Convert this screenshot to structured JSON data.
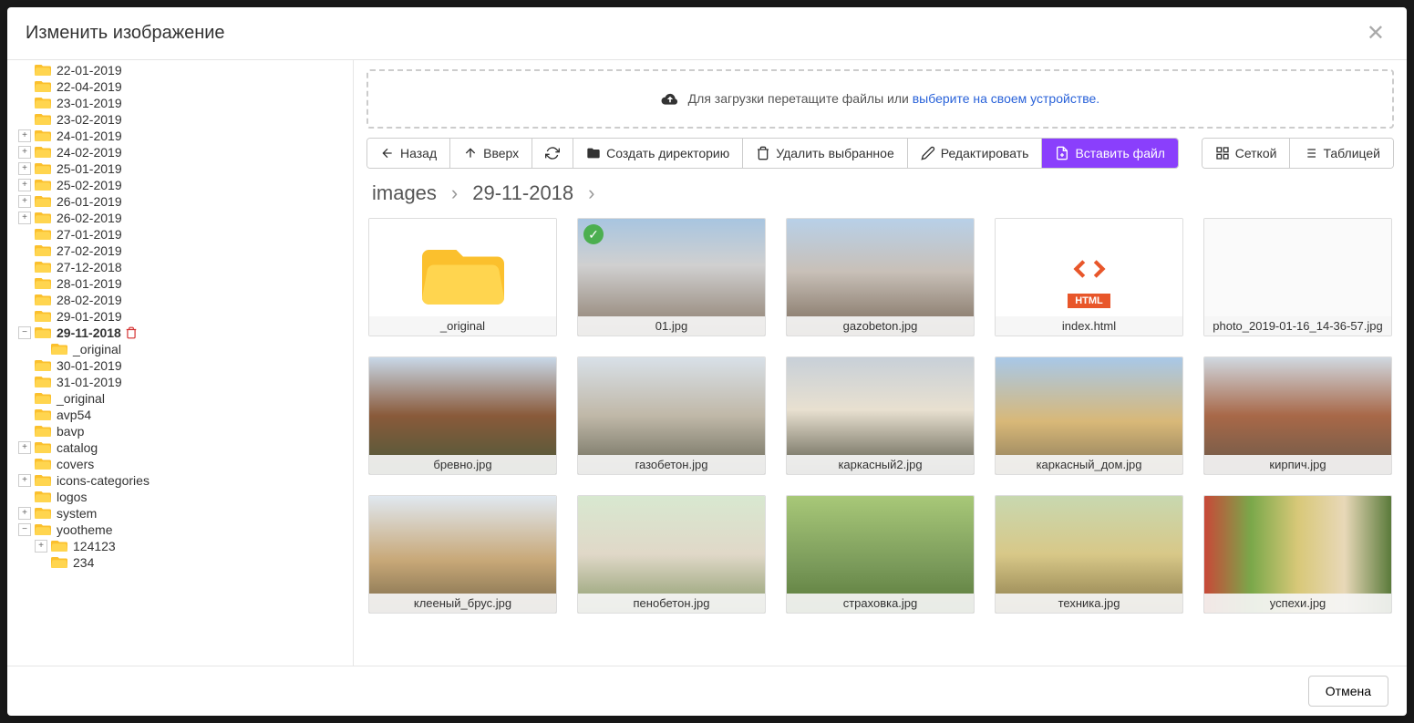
{
  "modal": {
    "title": "Изменить изображение",
    "cancel": "Отмена"
  },
  "tree": {
    "items": [
      {
        "label": "22-01-2019",
        "indent": 1,
        "expand": null
      },
      {
        "label": "22-04-2019",
        "indent": 1,
        "expand": null
      },
      {
        "label": "23-01-2019",
        "indent": 1,
        "expand": null
      },
      {
        "label": "23-02-2019",
        "indent": 1,
        "expand": null
      },
      {
        "label": "24-01-2019",
        "indent": 1,
        "expand": "+"
      },
      {
        "label": "24-02-2019",
        "indent": 1,
        "expand": "+"
      },
      {
        "label": "25-01-2019",
        "indent": 1,
        "expand": "+"
      },
      {
        "label": "25-02-2019",
        "indent": 1,
        "expand": "+"
      },
      {
        "label": "26-01-2019",
        "indent": 1,
        "expand": "+"
      },
      {
        "label": "26-02-2019",
        "indent": 1,
        "expand": "+"
      },
      {
        "label": "27-01-2019",
        "indent": 1,
        "expand": null
      },
      {
        "label": "27-02-2019",
        "indent": 1,
        "expand": null
      },
      {
        "label": "27-12-2018",
        "indent": 1,
        "expand": null
      },
      {
        "label": "28-01-2019",
        "indent": 1,
        "expand": null
      },
      {
        "label": "28-02-2019",
        "indent": 1,
        "expand": null
      },
      {
        "label": "29-01-2019",
        "indent": 1,
        "expand": null
      },
      {
        "label": "29-11-2018",
        "indent": 1,
        "expand": "−",
        "selected": true,
        "delete": true
      },
      {
        "label": "_original",
        "indent": 2,
        "expand": null
      },
      {
        "label": "30-01-2019",
        "indent": 1,
        "expand": null
      },
      {
        "label": "31-01-2019",
        "indent": 1,
        "expand": null
      },
      {
        "label": "_original",
        "indent": 1,
        "expand": null
      },
      {
        "label": "avp54",
        "indent": 1,
        "expand": null
      },
      {
        "label": "bavp",
        "indent": 1,
        "expand": null
      },
      {
        "label": "catalog",
        "indent": 1,
        "expand": "+"
      },
      {
        "label": "covers",
        "indent": 1,
        "expand": null
      },
      {
        "label": "icons-categories",
        "indent": 1,
        "expand": "+"
      },
      {
        "label": "logos",
        "indent": 1,
        "expand": null
      },
      {
        "label": "system",
        "indent": 1,
        "expand": "+"
      },
      {
        "label": "yootheme",
        "indent": 1,
        "expand": "−"
      },
      {
        "label": "124123",
        "indent": 2,
        "expand": "+"
      },
      {
        "label": "234",
        "indent": 2,
        "expand": null
      }
    ]
  },
  "dropzone": {
    "text": "Для загрузки перетащите файлы или ",
    "link": "выберите на своем устройстве."
  },
  "toolbar": {
    "back": "Назад",
    "up": "Вверх",
    "create_dir": "Создать директорию",
    "delete": "Удалить выбранное",
    "edit": "Редактировать",
    "insert": "Вставить файл",
    "grid": "Сеткой",
    "table": "Таблицей"
  },
  "breadcrumb": {
    "root": "images",
    "current": "29-11-2018"
  },
  "files": [
    {
      "name": "_original",
      "type": "folder"
    },
    {
      "name": "01.jpg",
      "type": "image",
      "cls": "img-house1",
      "selected": true
    },
    {
      "name": "gazobeton.jpg",
      "type": "image",
      "cls": "img-house2"
    },
    {
      "name": "index.html",
      "type": "html"
    },
    {
      "name": "photo_2019-01-16_14-36-57.jpg",
      "type": "image",
      "cls": "img-thumblist"
    },
    {
      "name": "бревно.jpg",
      "type": "image",
      "cls": "img-log"
    },
    {
      "name": "газобетон.jpg",
      "type": "image",
      "cls": "img-gas"
    },
    {
      "name": "каркасный2.jpg",
      "type": "image",
      "cls": "img-frame"
    },
    {
      "name": "каркасный_дом.jpg",
      "type": "image",
      "cls": "img-frame2"
    },
    {
      "name": "кирпич.jpg",
      "type": "image",
      "cls": "img-brick"
    },
    {
      "name": "клееный_брус.jpg",
      "type": "image",
      "cls": "img-glulam"
    },
    {
      "name": "пенобетон.jpg",
      "type": "image",
      "cls": "img-foam"
    },
    {
      "name": "страховка.jpg",
      "type": "image",
      "cls": "img-insure"
    },
    {
      "name": "техника.jpg",
      "type": "image",
      "cls": "img-tech"
    },
    {
      "name": "успехи.jpg",
      "type": "image",
      "cls": "img-success"
    }
  ]
}
